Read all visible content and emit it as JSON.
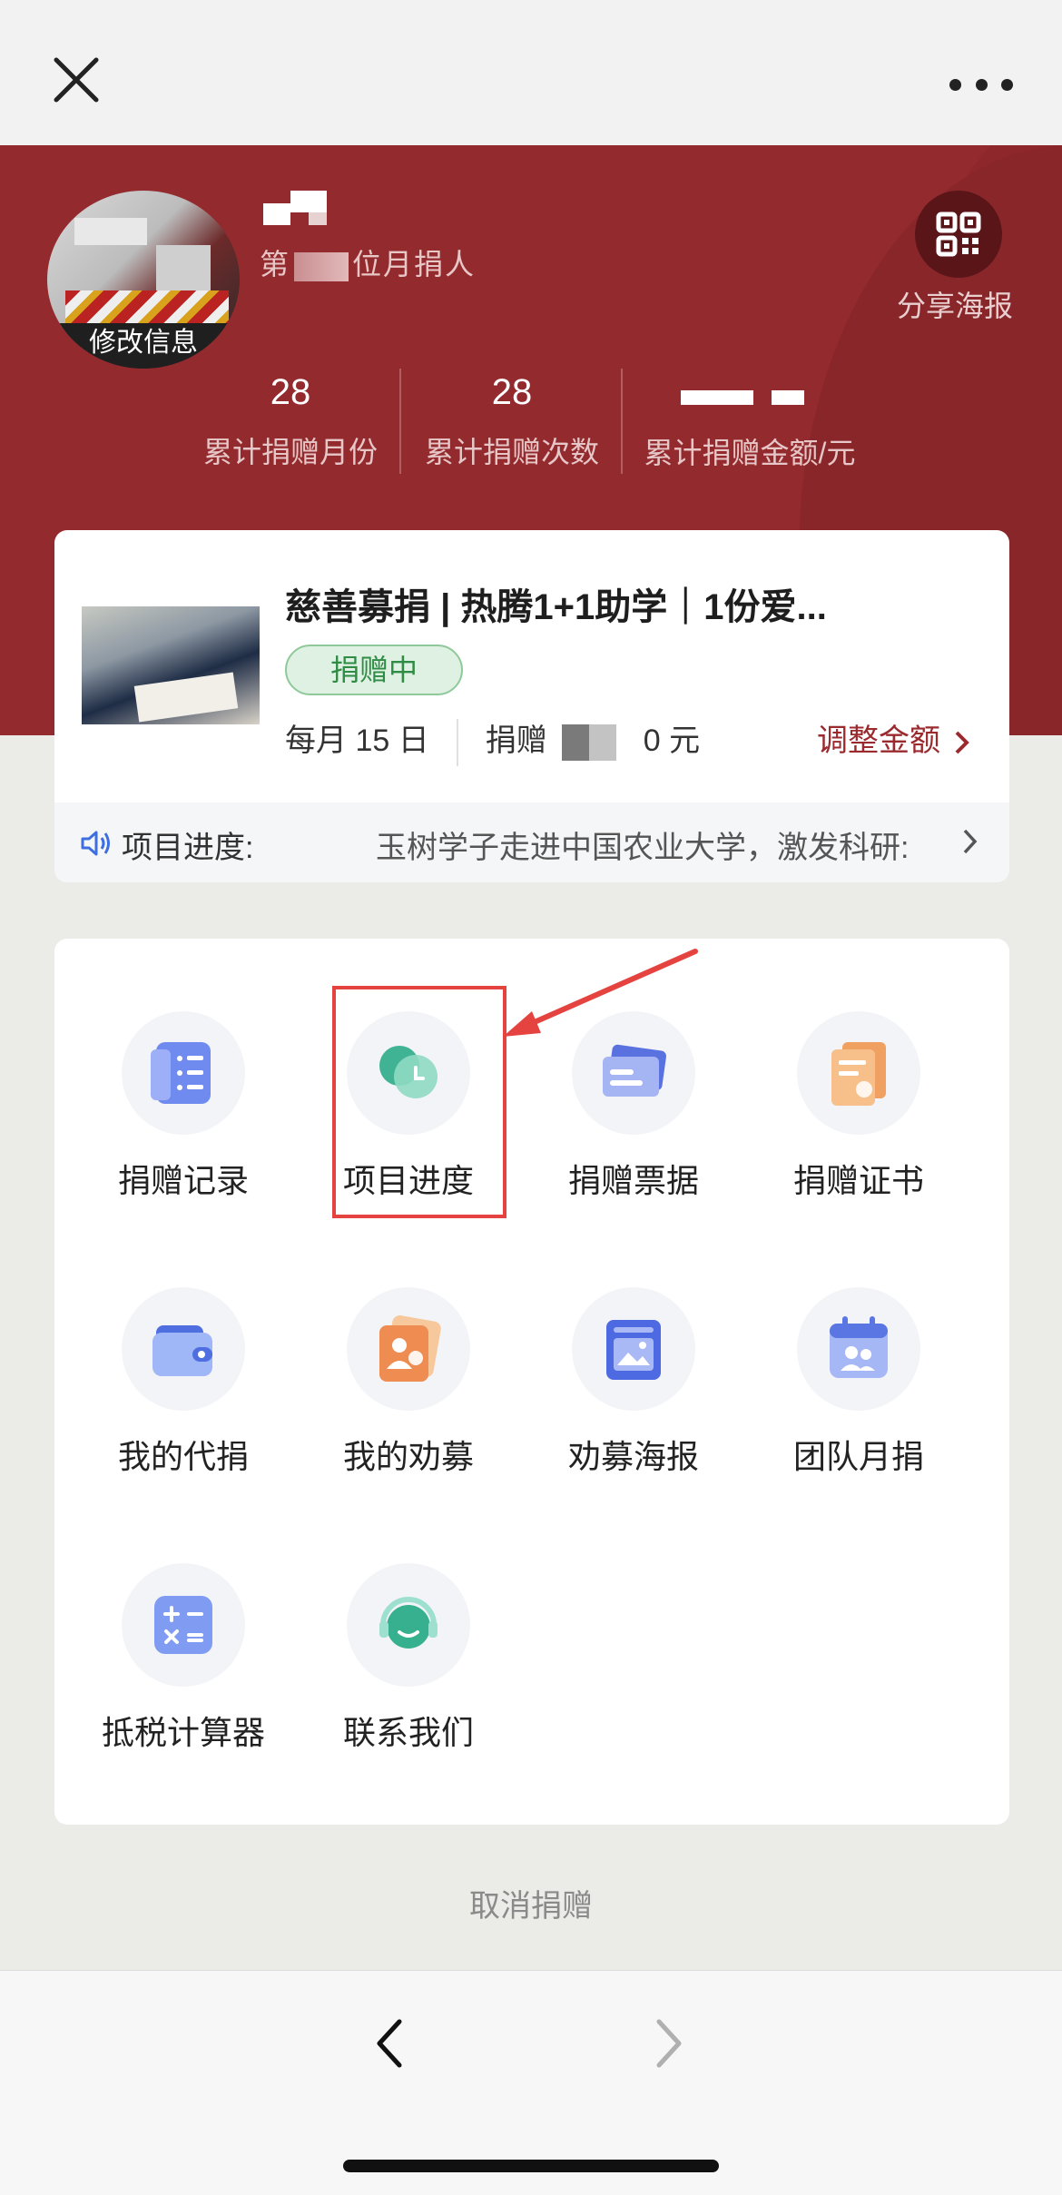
{
  "topbar": {
    "close_icon": "close-icon",
    "more_icon": "more-icon"
  },
  "profile": {
    "avatar_edit_label": "修改信息",
    "rank_prefix": "第",
    "rank_suffix": "位月捐人",
    "share_label": "分享海报"
  },
  "stats": [
    {
      "value": "28",
      "label": "累计捐赠月份"
    },
    {
      "value": "28",
      "label": "累计捐赠次数"
    },
    {
      "value": "",
      "label": "累计捐赠金额/元"
    }
  ],
  "project": {
    "title": "慈善募捐 | 热腾1+1助学｜1份爱...",
    "status": "捐赠中",
    "schedule": "每月 15 日",
    "donate_label": "捐赠",
    "donate_unit": "0 元",
    "adjust_label": "调整金额",
    "progress_label": "项目进度:",
    "progress_text": "玉树学子走进中国农业大学，激发科研:"
  },
  "grid": [
    {
      "label": "捐赠记录",
      "icon": "donation-record-icon"
    },
    {
      "label": "项目进度",
      "icon": "project-progress-icon"
    },
    {
      "label": "捐赠票据",
      "icon": "donation-receipt-icon"
    },
    {
      "label": "捐赠证书",
      "icon": "donation-certificate-icon"
    },
    {
      "label": "我的代捐",
      "icon": "wallet-icon"
    },
    {
      "label": "我的劝募",
      "icon": "fundraise-icon"
    },
    {
      "label": "劝募海报",
      "icon": "poster-icon"
    },
    {
      "label": "团队月捐",
      "icon": "team-calendar-icon"
    },
    {
      "label": "抵税计算器",
      "icon": "calculator-icon"
    },
    {
      "label": "联系我们",
      "icon": "support-icon"
    }
  ],
  "cancel_label": "取消捐赠",
  "colors": {
    "brand_red": "#932a2e",
    "highlight": "#e5433f",
    "status_green": "#2e8c45"
  }
}
